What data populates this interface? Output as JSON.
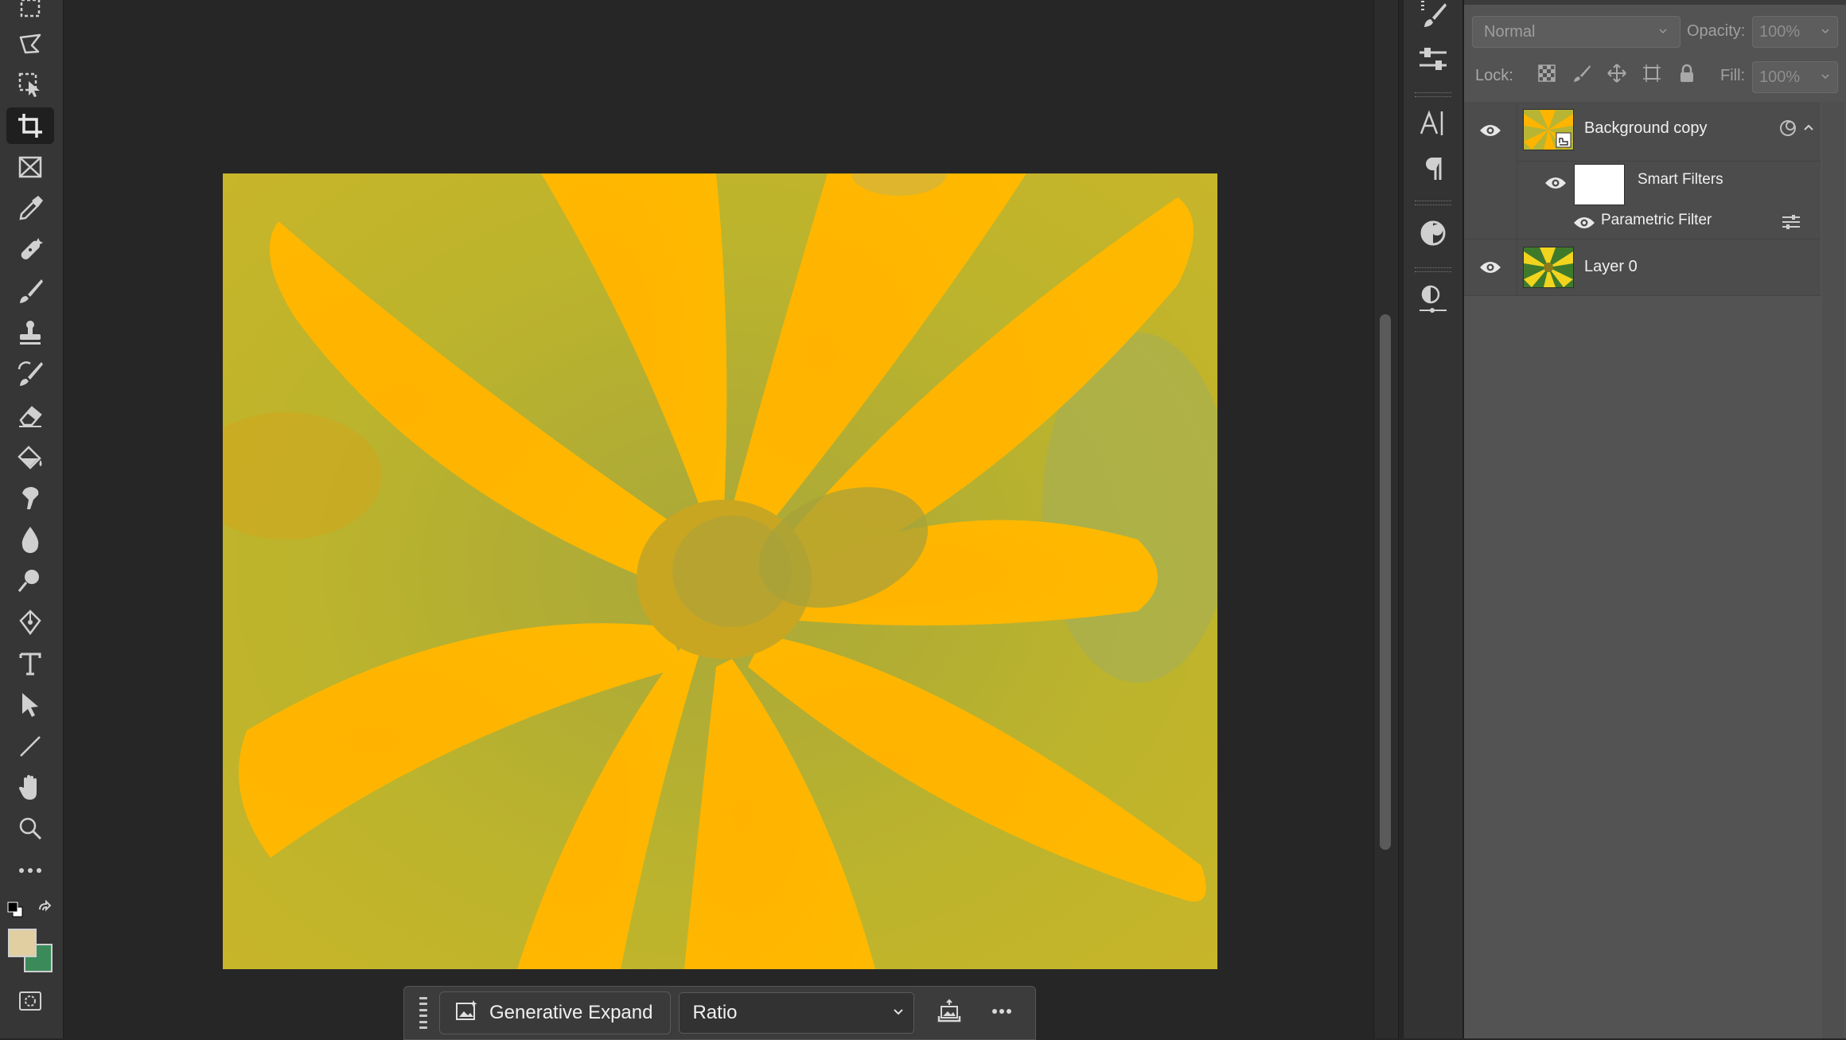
{
  "toolbar": {
    "tools": [
      {
        "name": "rectangular-marquee-tool",
        "active": false
      },
      {
        "name": "lasso-tool",
        "active": false
      },
      {
        "name": "object-selection-tool",
        "active": false
      },
      {
        "name": "crop-tool",
        "active": true
      },
      {
        "name": "frame-tool",
        "active": false
      },
      {
        "name": "eyedropper-tool",
        "active": false
      },
      {
        "name": "spot-healing-brush-tool",
        "active": false
      },
      {
        "name": "brush-tool",
        "active": false
      },
      {
        "name": "clone-stamp-tool",
        "active": false
      },
      {
        "name": "history-brush-tool",
        "active": false
      },
      {
        "name": "eraser-tool",
        "active": false
      },
      {
        "name": "paint-bucket-tool",
        "active": false
      },
      {
        "name": "smudge-tool",
        "active": false
      },
      {
        "name": "blur-tool",
        "active": false
      },
      {
        "name": "dodge-tool",
        "active": false
      },
      {
        "name": "pen-tool",
        "active": false
      },
      {
        "name": "type-tool",
        "active": false
      },
      {
        "name": "path-selection-tool",
        "active": false
      },
      {
        "name": "line-tool",
        "active": false
      },
      {
        "name": "hand-tool",
        "active": false
      },
      {
        "name": "zoom-tool",
        "active": false
      },
      {
        "name": "edit-toolbar",
        "active": false
      }
    ],
    "foreground_color": "#e1cfa2",
    "background_color": "#3b8b5a"
  },
  "canvas": {
    "image_description_colors": {
      "petal": "#ffb600",
      "background": "#b8b534"
    }
  },
  "contextual_taskbar": {
    "generate_label": "Generative Expand",
    "ratio_value": "Ratio"
  },
  "layers_panel": {
    "blend_mode": "Normal",
    "opacity_label": "Opacity:",
    "opacity_value": "100%",
    "lock_label": "Lock:",
    "fill_label": "Fill:",
    "fill_value": "100%",
    "layers": [
      {
        "name": "Background copy",
        "visible": true,
        "smart_object": true
      },
      {
        "name": "Layer 0",
        "visible": true,
        "smart_object": false
      }
    ],
    "smart_filters_label": "Smart Filters",
    "filter_name": "Parametric Filter"
  },
  "colors": {
    "ui_dark": "#262626",
    "panel": "#535353",
    "toolbar": "#363636",
    "accent_icon": "#d0d0d0"
  }
}
